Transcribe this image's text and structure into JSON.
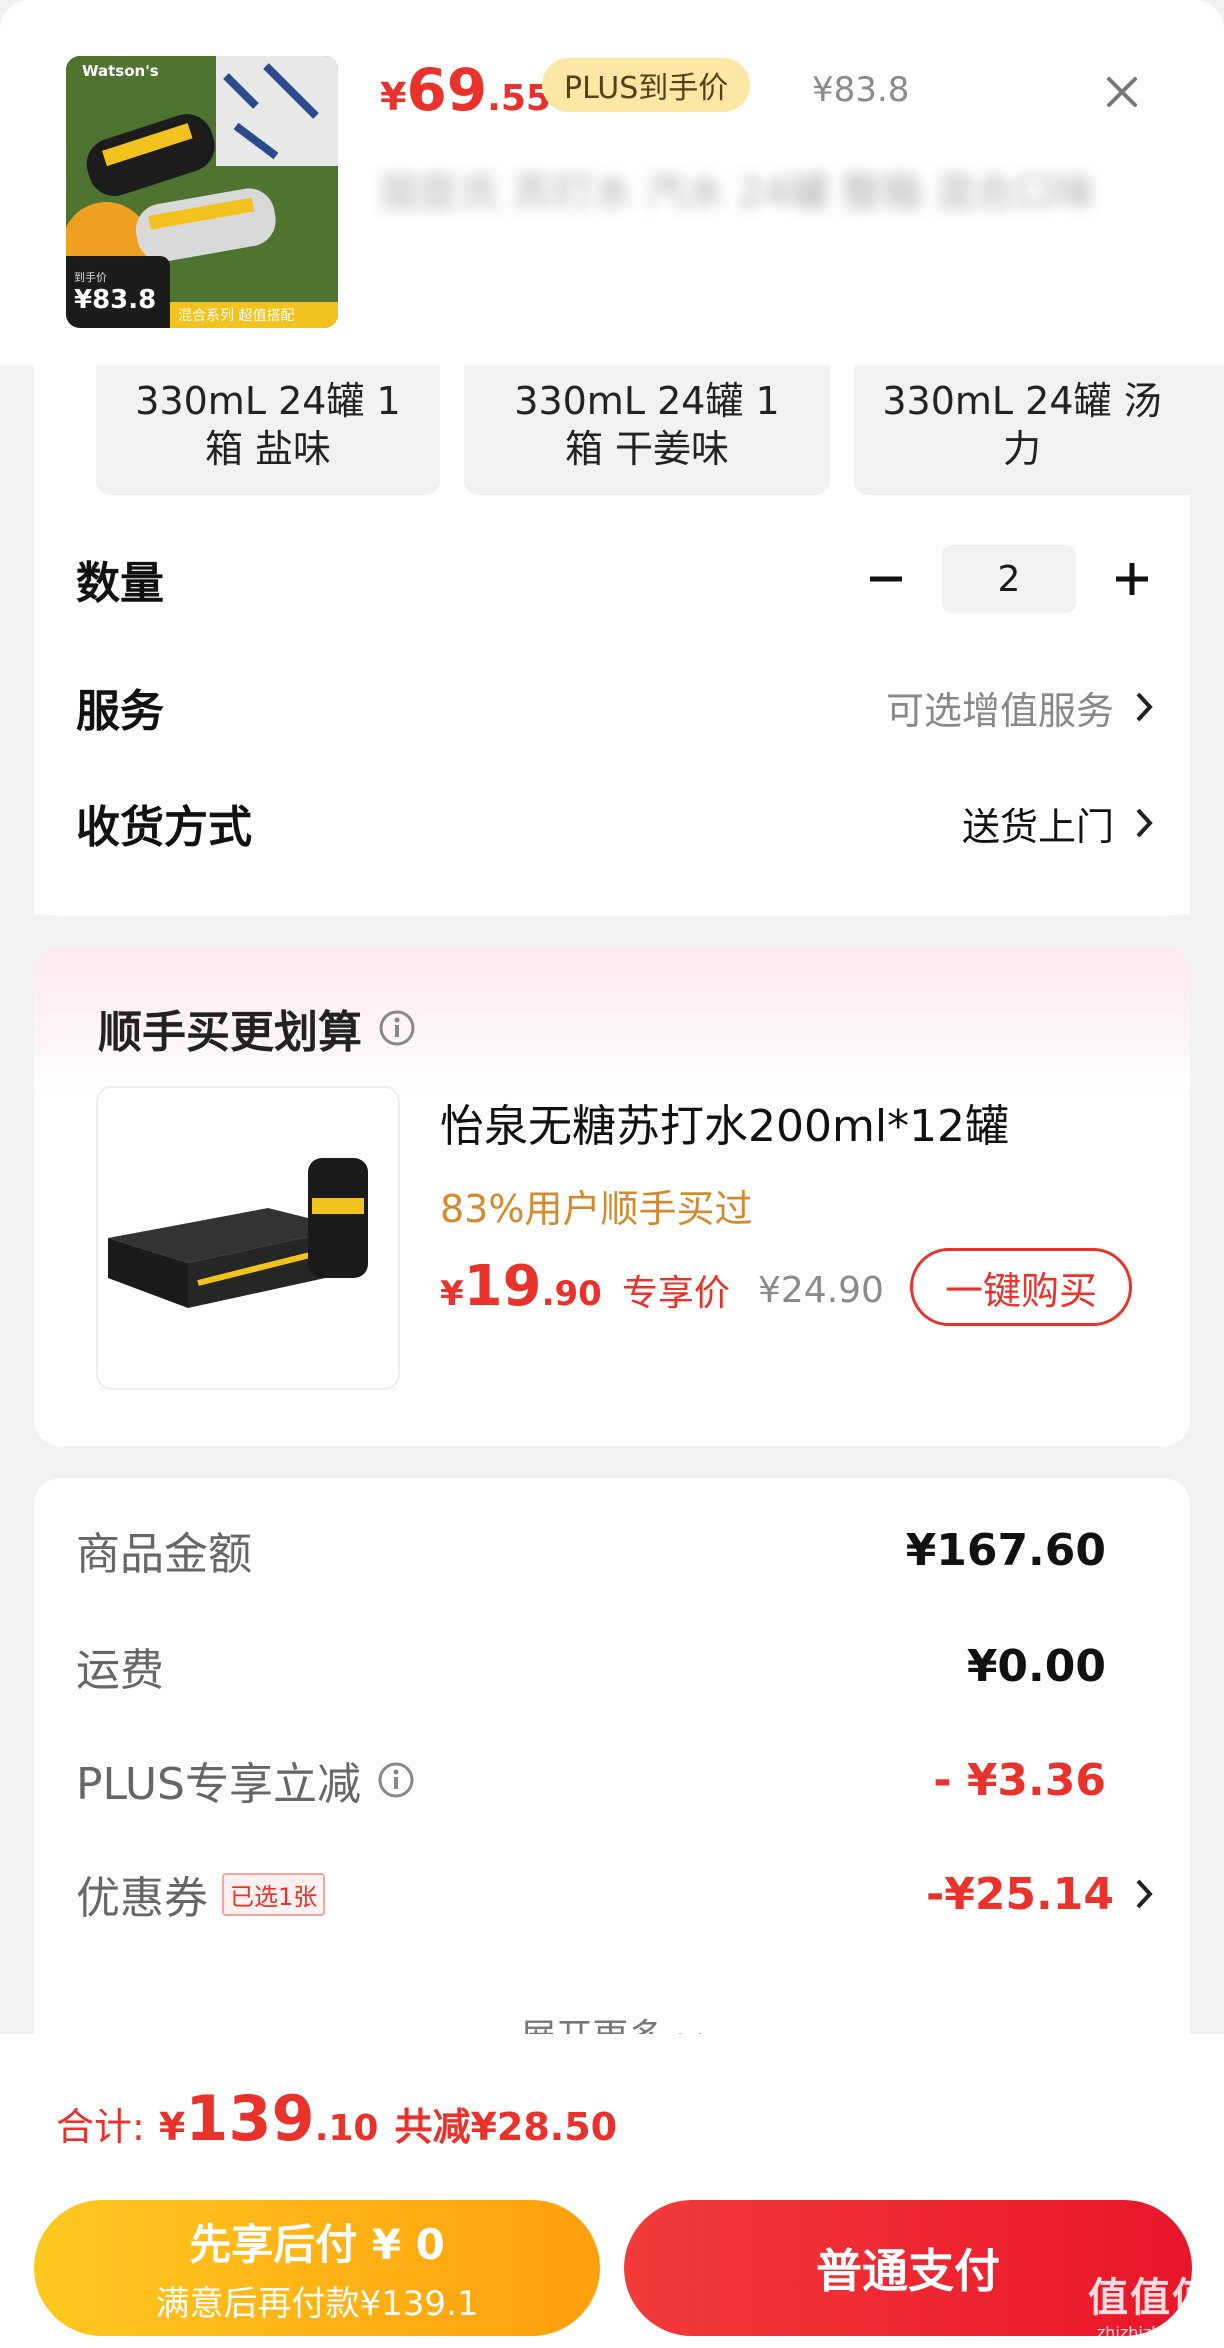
{
  "product": {
    "brand_mark": "Watson's",
    "thumb_badge_label": "到手价",
    "thumb_badge_price": "¥83.8",
    "thumb_strip": "混合系列 超值搭配",
    "price_symbol": "¥",
    "price_int": "69",
    "price_dec": ".55",
    "plus_label": "PLUS到手价",
    "original_price": "¥83.8",
    "title_blurred": "屈臣氏 苏打水 汽水 24罐 整箱 混合口味"
  },
  "specs": [
    {
      "label": "330mL 24罐 1\n箱 盐味"
    },
    {
      "label": "330mL 24罐 1\n箱 干姜味"
    },
    {
      "label": "330mL 24罐 汤\n力"
    }
  ],
  "quantity": {
    "label": "数量",
    "value": "2",
    "minus": "−",
    "plus": "+"
  },
  "service": {
    "label": "服务",
    "value": "可选增值服务"
  },
  "delivery": {
    "label": "收货方式",
    "value": "送货上门"
  },
  "bundle": {
    "title": "顺手买更划算",
    "name": "怡泉无糖苏打水200ml*12罐",
    "stat": "83%用户顺手买过",
    "price_symbol": "¥",
    "price_int": "19",
    "price_dec": ".90",
    "price_tag": "专享价",
    "original_price": "¥24.90",
    "buy_label": "一键购买"
  },
  "summary": {
    "goods_label": "商品金额",
    "goods_value": "¥167.60",
    "shipping_label": "运费",
    "shipping_value": "¥0.00",
    "plus_label": "PLUS专享立减",
    "plus_value": "- ¥3.36",
    "coupon_label": "优惠券",
    "coupon_tag": "已选1张",
    "coupon_value": "-¥25.14",
    "more_label": "展开更多"
  },
  "footer": {
    "total_label": "合计:",
    "total_symbol": "¥",
    "total_int": "139",
    "total_dec": ".10",
    "saved": "共减¥28.50",
    "later_title": "先享后付 ¥ 0",
    "later_sub": "满意后再付款¥139.1",
    "pay_label": "普通支付",
    "watermark_main": "值值值",
    "watermark_sub": "zhizhizhi.com"
  },
  "colors": {
    "accent_red": "#e8322b",
    "plus_gold": "#fbe7a6",
    "orange": "#d48a2c"
  }
}
